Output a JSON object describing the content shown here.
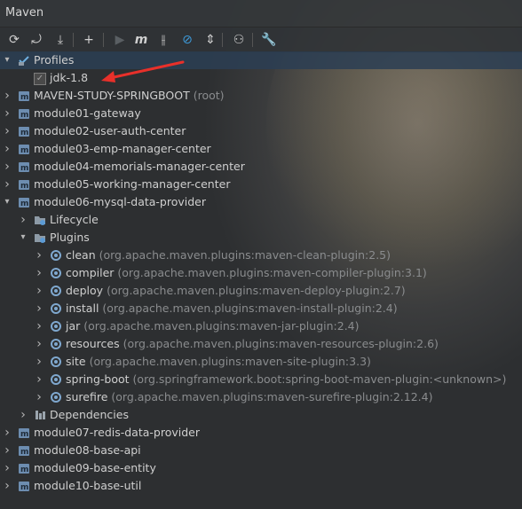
{
  "window": {
    "title": "Maven"
  },
  "toolbar": {
    "buttons": [
      {
        "name": "reload-all-icon",
        "glyph": "⟳"
      },
      {
        "name": "reload-project-icon",
        "glyph": "⤾"
      },
      {
        "name": "download-sources-icon",
        "glyph": "⤓"
      },
      {
        "name": "add-project-icon",
        "glyph": "+"
      },
      {
        "name": "run-icon",
        "glyph": "▶"
      },
      {
        "name": "execute-goal-icon",
        "glyph": "m"
      },
      {
        "name": "toggle-offline-icon",
        "glyph": "⫲"
      },
      {
        "name": "skip-tests-icon",
        "glyph": "⊘"
      },
      {
        "name": "collapse-all-icon",
        "glyph": "⇕"
      },
      {
        "name": "analyze-dependencies-icon",
        "glyph": "⚇"
      },
      {
        "name": "settings-wrench-icon",
        "glyph": "🔧"
      }
    ]
  },
  "tree": {
    "profiles": {
      "label": "Profiles",
      "items": [
        {
          "label": "jdk-1.8",
          "checked": true
        }
      ]
    },
    "root_module": {
      "label": "MAVEN-STUDY-SPRINGBOOT",
      "note": "(root)"
    },
    "modules_before": [
      "module01-gateway",
      "module02-user-auth-center",
      "module03-emp-manager-center",
      "module04-memorials-manager-center",
      "module05-working-manager-center"
    ],
    "expanded_module": {
      "label": "module06-mysql-data-provider",
      "lifecycle": "Lifecycle",
      "plugins_label": "Plugins",
      "plugins": [
        {
          "name": "clean",
          "coord": "(org.apache.maven.plugins:maven-clean-plugin:2.5)"
        },
        {
          "name": "compiler",
          "coord": "(org.apache.maven.plugins:maven-compiler-plugin:3.1)"
        },
        {
          "name": "deploy",
          "coord": "(org.apache.maven.plugins:maven-deploy-plugin:2.7)"
        },
        {
          "name": "install",
          "coord": "(org.apache.maven.plugins:maven-install-plugin:2.4)"
        },
        {
          "name": "jar",
          "coord": "(org.apache.maven.plugins:maven-jar-plugin:2.4)"
        },
        {
          "name": "resources",
          "coord": "(org.apache.maven.plugins:maven-resources-plugin:2.6)"
        },
        {
          "name": "site",
          "coord": "(org.apache.maven.plugins:maven-site-plugin:3.3)"
        },
        {
          "name": "spring-boot",
          "coord": "(org.springframework.boot:spring-boot-maven-plugin:<unknown>)"
        },
        {
          "name": "surefire",
          "coord": "(org.apache.maven.plugins:maven-surefire-plugin:2.12.4)"
        }
      ],
      "dependencies": "Dependencies"
    },
    "modules_after": [
      "module07-redis-data-provider",
      "module08-base-api",
      "module09-base-entity",
      "module10-base-util"
    ]
  },
  "colors": {
    "selection": "#2b3e54",
    "arrow": "#e8302a",
    "text": "#cfcfcf",
    "muted": "#8a8c8e"
  }
}
